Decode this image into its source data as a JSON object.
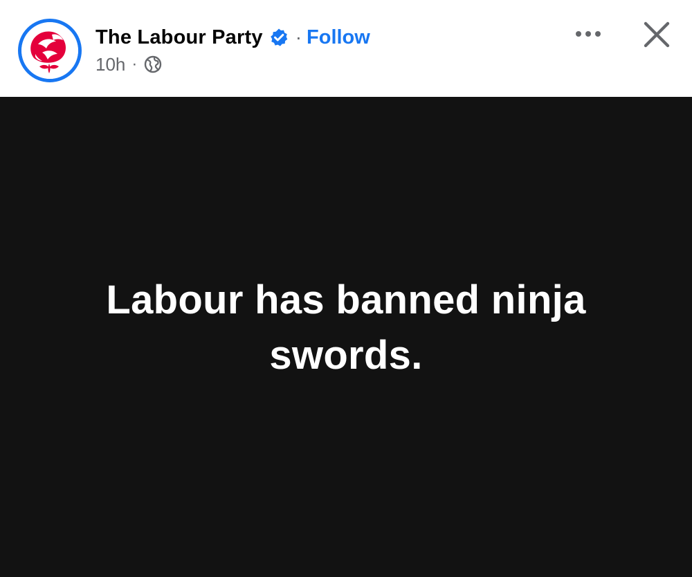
{
  "header": {
    "page_name": "The Labour Party",
    "separator": "·",
    "follow_label": "Follow",
    "timestamp": "10h",
    "meta_separator": "·",
    "verified_icon": "verified-badge-icon",
    "audience_icon": "globe-icon",
    "more_icon": "more-options-icon",
    "close_icon": "close-icon",
    "avatar_icon": "labour-rose-logo"
  },
  "post": {
    "text": "Labour has banned ninja swords."
  },
  "colors": {
    "accent": "#1877f2",
    "rose": "#e4003b",
    "post_background": "#121212",
    "post_text": "#ffffff",
    "muted": "#65676b"
  }
}
